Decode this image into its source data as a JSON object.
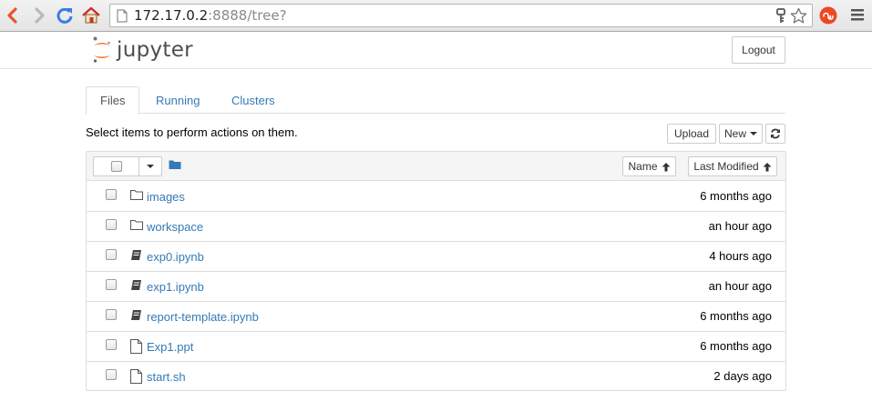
{
  "browser": {
    "url_host": "172.17.0.2",
    "url_rest": ":8888/tree?"
  },
  "header": {
    "logo_text": "jupyter",
    "logout_label": "Logout"
  },
  "tabs": [
    {
      "label": "Files",
      "active": true
    },
    {
      "label": "Running",
      "active": false
    },
    {
      "label": "Clusters",
      "active": false
    }
  ],
  "toolbar": {
    "hint": "Select items to perform actions on them.",
    "upload_label": "Upload",
    "new_label": "New"
  },
  "list_header": {
    "name_label": "Name",
    "modified_label": "Last Modified"
  },
  "files": [
    {
      "name": "images",
      "type": "folder",
      "modified": "6 months ago"
    },
    {
      "name": "workspace",
      "type": "folder",
      "modified": "an hour ago"
    },
    {
      "name": "exp0.ipynb",
      "type": "notebook",
      "modified": "4 hours ago"
    },
    {
      "name": "exp1.ipynb",
      "type": "notebook",
      "modified": "an hour ago"
    },
    {
      "name": "report-template.ipynb",
      "type": "notebook",
      "modified": "6 months ago"
    },
    {
      "name": "Exp1.ppt",
      "type": "file",
      "modified": "6 months ago"
    },
    {
      "name": "start.sh",
      "type": "file",
      "modified": "2 days ago"
    }
  ],
  "colors": {
    "link": "#337ab7",
    "jupyter_orange": "#f37726",
    "back_arrow": "#e8562a",
    "reload": "#3b7ce0"
  }
}
